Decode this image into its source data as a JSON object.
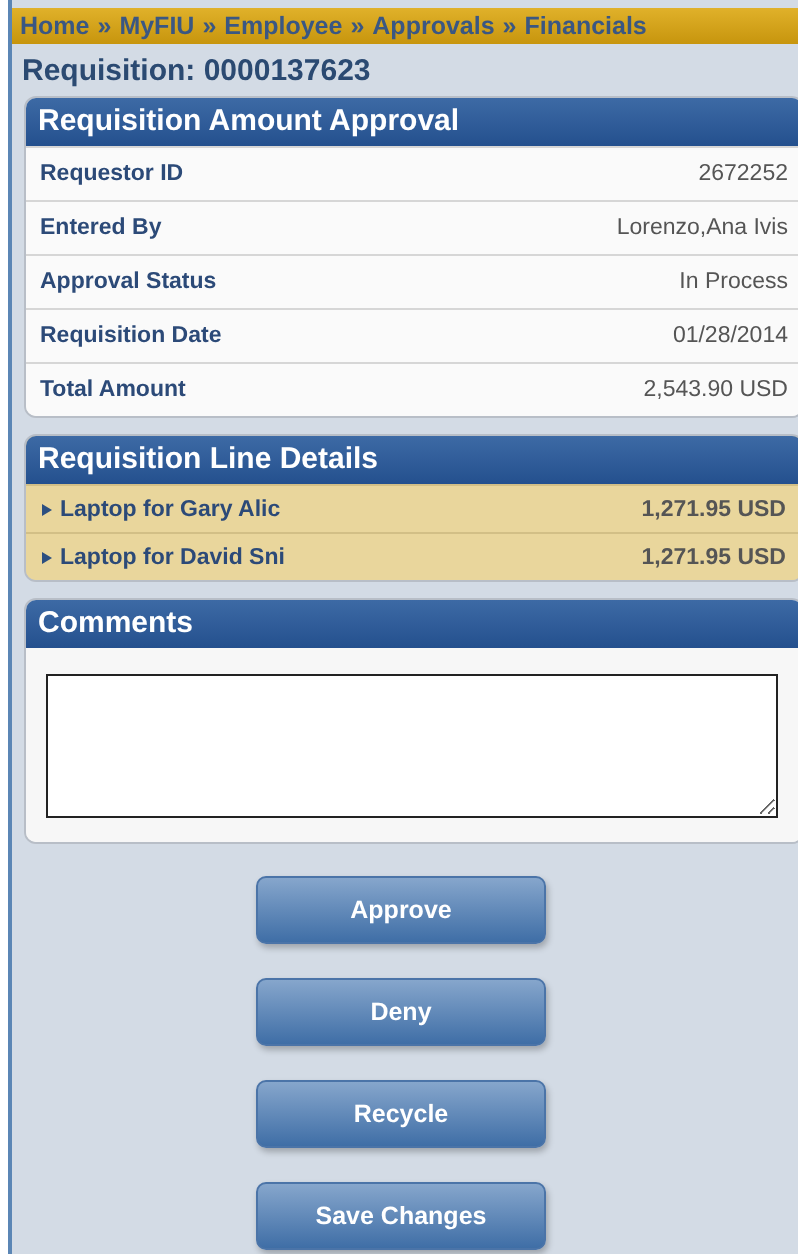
{
  "breadcrumb": [
    "Home",
    "MyFIU",
    "Employee",
    "Approvals",
    "Financials"
  ],
  "breadcrumb_separator": "»",
  "page_title": "Requisition: 0000137623",
  "amount_approval": {
    "title": "Requisition Amount Approval",
    "rows": [
      {
        "label": "Requestor ID",
        "value": "2672252"
      },
      {
        "label": "Entered By",
        "value": "Lorenzo,Ana Ivis"
      },
      {
        "label": "Approval Status",
        "value": "In Process"
      },
      {
        "label": "Requisition Date",
        "value": "01/28/2014"
      },
      {
        "label": "Total Amount",
        "value": "2,543.90 USD"
      }
    ]
  },
  "line_details": {
    "title": "Requisition Line Details",
    "lines": [
      {
        "description": "Laptop for Gary Alic",
        "amount": "1,271.95 USD"
      },
      {
        "description": "Laptop for David Sni",
        "amount": "1,271.95 USD"
      }
    ]
  },
  "comments": {
    "title": "Comments"
  },
  "buttons": [
    "Approve",
    "Deny",
    "Recycle",
    "Save Changes"
  ]
}
